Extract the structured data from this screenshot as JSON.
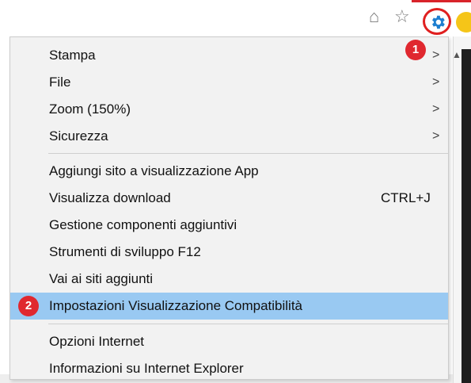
{
  "toolbar": {
    "icons": [
      "home-icon",
      "star-icon",
      "gear-icon",
      "smiley-icon"
    ]
  },
  "badges": {
    "one": "1",
    "two": "2"
  },
  "menu": {
    "items": [
      {
        "label": "Stampa",
        "arrow": ">"
      },
      {
        "label": "File",
        "arrow": ">"
      },
      {
        "label": "Zoom (150%)",
        "arrow": ">"
      },
      {
        "label": "Sicurezza",
        "arrow": ">"
      },
      {
        "label": "Aggiungi sito a visualizzazione App"
      },
      {
        "label": "Visualizza download",
        "shortcut": "CTRL+J"
      },
      {
        "label": "Gestione componenti aggiuntivi"
      },
      {
        "label": "Strumenti di sviluppo F12"
      },
      {
        "label": "Vai ai siti aggiunti"
      },
      {
        "label": "Impostazioni Visualizzazione Compatibilità"
      },
      {
        "label": "Opzioni Internet"
      },
      {
        "label": "Informazioni su Internet Explorer"
      }
    ]
  },
  "colors": {
    "highlight": "#99c9f2",
    "badge": "#e0282f",
    "gear": "#1e7fd0"
  }
}
